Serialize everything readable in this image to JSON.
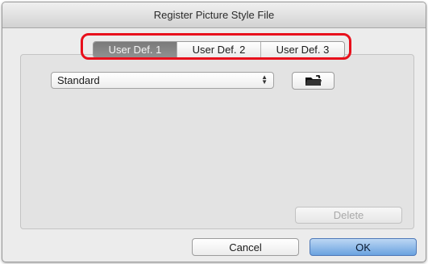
{
  "window": {
    "title": "Register Picture Style File"
  },
  "tabs": [
    {
      "label": "User Def. 1",
      "selected": true
    },
    {
      "label": "User Def. 2",
      "selected": false
    },
    {
      "label": "User Def. 3",
      "selected": false
    }
  ],
  "style_select": {
    "value": "Standard"
  },
  "icons": {
    "open_file": "open-folder-icon",
    "popup_arrows": "updown-arrows-icon"
  },
  "buttons": {
    "delete": "Delete",
    "cancel": "Cancel",
    "ok": "OK"
  },
  "colors": {
    "highlight": "#e8101c",
    "selected_tab": "#7a7a7a",
    "ok_accent": "#6aa2e0"
  }
}
